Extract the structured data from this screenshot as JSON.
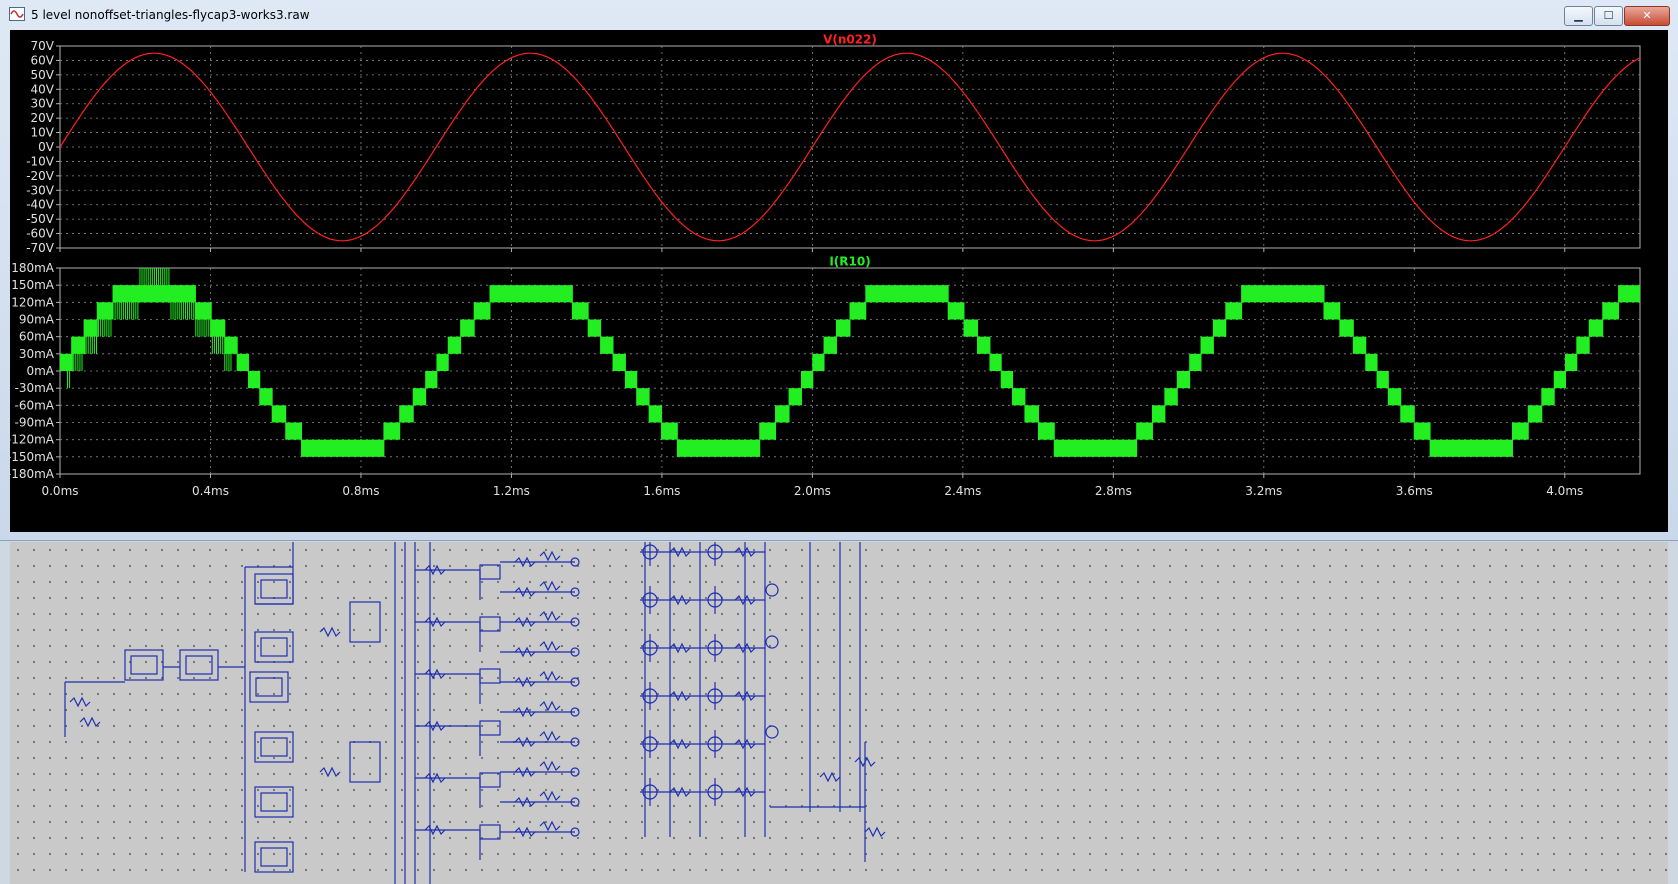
{
  "window": {
    "title": "5 level nonoffset-triangles-flycap3-works3.raw",
    "icon": "waveform-icon",
    "controls": {
      "minimize": "▁",
      "maximize": "☐",
      "close": "✕"
    }
  },
  "chart_data": [
    {
      "type": "line",
      "title": "V(n022)",
      "color": "#ff2020",
      "ylim": [
        -70,
        70
      ],
      "yticks": [
        "70V",
        "60V",
        "50V",
        "40V",
        "30V",
        "20V",
        "10V",
        "0V",
        "-10V",
        "-20V",
        "-30V",
        "-40V",
        "-50V",
        "-60V",
        "-70V"
      ],
      "xlim": [
        0,
        4.2
      ],
      "xticks": [
        "0.0ms",
        "0.4ms",
        "0.8ms",
        "1.2ms",
        "1.6ms",
        "2.0ms",
        "2.4ms",
        "2.8ms",
        "3.2ms",
        "3.6ms",
        "4.0ms"
      ],
      "series": [
        {
          "name": "V(n022)",
          "amplitude": 65,
          "frequency_khz": 1,
          "unit": "V"
        }
      ],
      "grid": true
    },
    {
      "type": "area",
      "title": "I(R10)",
      "color": "#22ee22",
      "ylim": [
        -180,
        180
      ],
      "yticks": [
        "180mA",
        "150mA",
        "120mA",
        "90mA",
        "60mA",
        "30mA",
        "0mA",
        "-30mA",
        "-60mA",
        "-90mA",
        "-120mA",
        "-150mA",
        "-180mA"
      ],
      "xlim": [
        0,
        4.2
      ],
      "xticks": [
        "0.0ms",
        "0.4ms",
        "0.8ms",
        "1.2ms",
        "1.6ms",
        "2.0ms",
        "2.4ms",
        "2.8ms",
        "3.2ms",
        "3.6ms",
        "4.0ms"
      ],
      "series": [
        {
          "name": "I(R10)",
          "levels_ma": [
            -150,
            -120,
            -90,
            -60,
            -30,
            0,
            30,
            60,
            90,
            120,
            150
          ],
          "frequency_khz": 1
        }
      ],
      "grid": true
    }
  ]
}
